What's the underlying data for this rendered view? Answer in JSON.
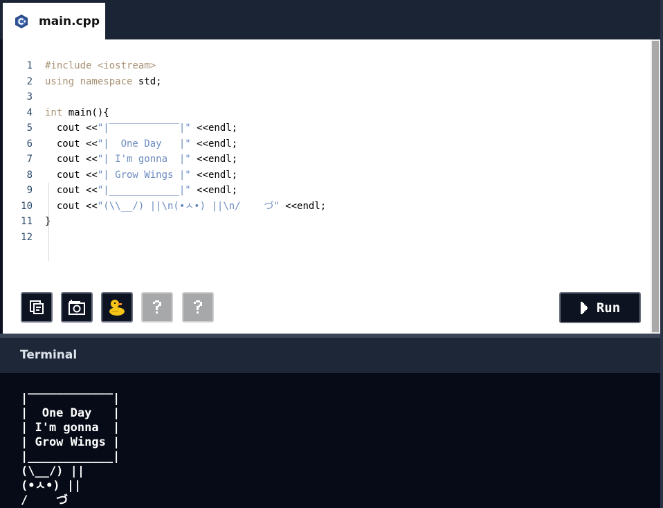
{
  "tab": {
    "label": "main.cpp",
    "icon": "cpp-file-icon"
  },
  "editor": {
    "lines": [
      {
        "n": "1",
        "segs": [
          {
            "t": "#include <iostream>",
            "c": "kw"
          }
        ]
      },
      {
        "n": "2",
        "segs": [
          {
            "t": "using namespace ",
            "c": "kw"
          },
          {
            "t": "std;",
            "c": ""
          }
        ]
      },
      {
        "n": "3",
        "segs": []
      },
      {
        "n": "4",
        "segs": [
          {
            "t": "int ",
            "c": "kw"
          },
          {
            "t": "main(){",
            "c": ""
          }
        ]
      },
      {
        "n": "5",
        "segs": [
          {
            "t": "  cout <<",
            "c": ""
          },
          {
            "t": "\"|‾‾‾‾‾‾‾‾‾‾‾‾|\"",
            "c": "str"
          },
          {
            "t": " <<endl;",
            "c": ""
          }
        ]
      },
      {
        "n": "6",
        "segs": [
          {
            "t": "  cout <<",
            "c": ""
          },
          {
            "t": "\"|  One Day   |\"",
            "c": "str"
          },
          {
            "t": " <<endl;",
            "c": ""
          }
        ]
      },
      {
        "n": "7",
        "segs": [
          {
            "t": "  cout <<",
            "c": ""
          },
          {
            "t": "\"| I'm gonna  |\"",
            "c": "str"
          },
          {
            "t": " <<endl;",
            "c": ""
          }
        ]
      },
      {
        "n": "8",
        "segs": [
          {
            "t": "  cout <<",
            "c": ""
          },
          {
            "t": "\"| Grow Wings |\"",
            "c": "str"
          },
          {
            "t": " <<endl;",
            "c": ""
          }
        ]
      },
      {
        "n": "9",
        "segs": [
          {
            "t": "  cout <<",
            "c": ""
          },
          {
            "t": "\"|____________|\"",
            "c": "str"
          },
          {
            "t": " <<endl;",
            "c": ""
          }
        ]
      },
      {
        "n": "10",
        "segs": [
          {
            "t": "  cout <<",
            "c": ""
          },
          {
            "t": "\"(\\\\__/) ||\\n(•ㅅ•) ||\\n/    づ\"",
            "c": "str"
          },
          {
            "t": " <<endl;",
            "c": ""
          }
        ]
      },
      {
        "n": "11",
        "segs": [
          {
            "t": "}",
            "c": ""
          }
        ]
      },
      {
        "n": "12",
        "segs": []
      }
    ]
  },
  "toolbar": {
    "buttons": [
      {
        "name": "copy-code-button",
        "icon": "copy-icon",
        "enabled": true
      },
      {
        "name": "screenshot-button",
        "icon": "camera-icon",
        "enabled": true
      },
      {
        "name": "rubber-duck-button",
        "icon": "duck-icon",
        "enabled": true
      },
      {
        "name": "help-button-1",
        "icon": "question-icon",
        "enabled": false
      },
      {
        "name": "help-button-2",
        "icon": "question-icon",
        "enabled": false
      }
    ],
    "run_label": "Run"
  },
  "terminal": {
    "title": "Terminal",
    "output": "|‾‾‾‾‾‾‾‾‾‾‾‾|\n|  One Day   |\n| I'm gonna  |\n| Grow Wings |\n|____________|\n(\\__/) ||\n(•ㅅ•) ||\n/    づ"
  },
  "colors": {
    "topbar": "#1b2434",
    "keyword": "#a89274",
    "string": "#6b8bbf",
    "line_number": "#2c4a6b",
    "terminal_bg": "#070b17"
  }
}
